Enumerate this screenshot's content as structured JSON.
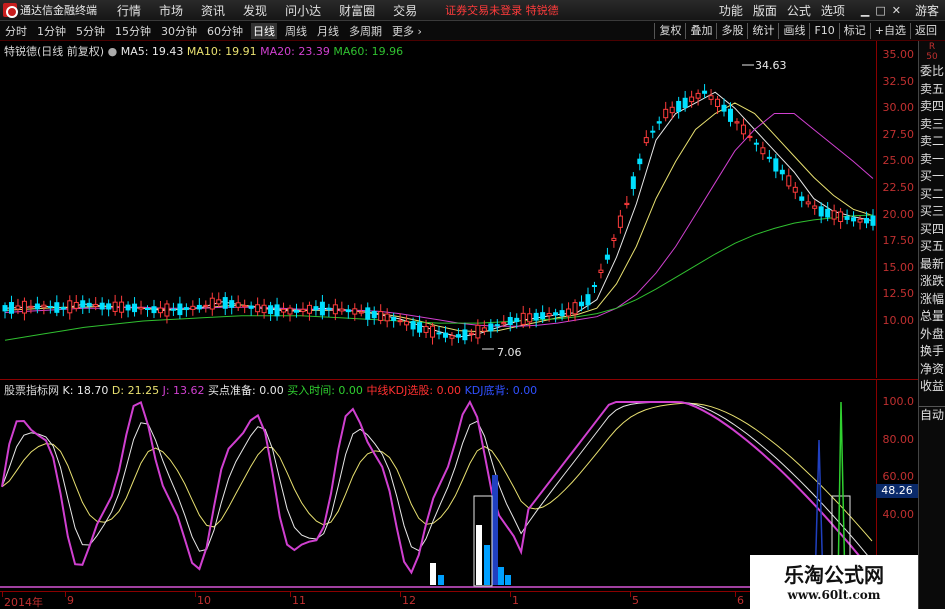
{
  "app": {
    "title": "通达信金融终端",
    "notice": "证券交易未登录",
    "notice2": "特锐德"
  },
  "menu": [
    "行情",
    "市场",
    "资讯",
    "发现",
    "问小达",
    "财富圈",
    "交易"
  ],
  "right_menu": [
    "功能",
    "版面",
    "公式",
    "选项",
    "游客"
  ],
  "periods": [
    "分时",
    "1分钟",
    "5分钟",
    "15分钟",
    "30分钟",
    "60分钟",
    "日线",
    "周线",
    "月线",
    "多周期",
    "更多"
  ],
  "active_period": "日线",
  "toolbar_right": [
    "复权",
    "叠加",
    "多股",
    "统计",
    "画线",
    "F10",
    "标记",
    "+自选",
    "返回"
  ],
  "price_legend": {
    "name": "特锐德(日线 前复权)",
    "ma5": "MA5: 19.43",
    "ma10": "MA10: 19.91",
    "ma20": "MA20: 23.39",
    "ma60": "MA60: 19.96"
  },
  "colors": {
    "up": "#ff3c3c",
    "down": "#00e0ff",
    "ma5": "#e8e8e8",
    "ma10": "#e8e070",
    "ma20": "#d040d0",
    "ma60": "#30c030"
  },
  "price_axis": [
    "35.00",
    "32.50",
    "30.00",
    "27.50",
    "25.00",
    "22.50",
    "20.00",
    "17.50",
    "15.00",
    "12.50",
    "10.00"
  ],
  "price_annotations": {
    "high": "34.63",
    "low": "7.06"
  },
  "ind_legend": {
    "name": "股票指标网",
    "k": "K: 18.70",
    "d": "D: 21.25",
    "j": "J: 13.62",
    "buy_prep": "买点准备: 0.00",
    "buy_time": "买入时间: 0.00",
    "mid": "中线KDJ选股: 0.00",
    "kdj": "KDJ底背: 0.00"
  },
  "ind_axis": [
    "100.0",
    "80.00",
    "60.00",
    "40.00"
  ],
  "ind_current": "48.26",
  "time_axis": [
    "2014年",
    "9",
    "10",
    "11",
    "12",
    "1",
    "5",
    "6"
  ],
  "side_buttons": [
    "委比",
    "卖五",
    "卖四",
    "卖三",
    "卖二",
    "卖一",
    "买一",
    "买二",
    "买三",
    "买四",
    "买五",
    "最新",
    "涨跌",
    "涨幅",
    "总量",
    "外盘",
    "换手",
    "净资",
    "收益",
    "自动"
  ],
  "side_top_label": "R\n50",
  "watermark": {
    "title": "乐淘公式网",
    "url": "www.60lt.com"
  },
  "chart_data": {
    "type": "line",
    "title": "特锐德(日线 前复权)",
    "ylim": [
      5,
      36
    ],
    "series": [
      {
        "name": "MA5",
        "values": [
          11.2,
          11.3,
          11.4,
          11.2,
          11.6,
          11.4,
          11.3,
          11.2,
          11.0,
          11.1,
          11.3,
          11.8,
          11.5,
          11.2,
          11.0,
          10.9,
          11.2,
          11.1,
          10.9,
          10.6,
          10.2,
          9.6,
          9.0,
          8.5,
          8.8,
          9.4,
          10.0,
          10.3,
          10.6,
          10.8,
          12.0,
          16,
          21,
          27,
          29.5,
          30.5,
          31.5,
          30,
          28,
          26,
          24,
          21.5,
          20.3,
          19.8,
          19.43
        ]
      },
      {
        "name": "MA10",
        "values": [
          11.0,
          11.1,
          11.2,
          11.3,
          11.3,
          11.4,
          11.3,
          11.2,
          11.1,
          11.1,
          11.2,
          11.4,
          11.5,
          11.3,
          11.1,
          11.0,
          11.0,
          11.0,
          10.9,
          10.7,
          10.4,
          10.0,
          9.5,
          9.1,
          9.0,
          9.1,
          9.5,
          9.9,
          10.3,
          10.6,
          11.2,
          13.5,
          17,
          21.5,
          25,
          28,
          29.5,
          30.5,
          29.5,
          27.5,
          25.5,
          23.5,
          21.8,
          20.5,
          19.91
        ]
      },
      {
        "name": "MA20",
        "values": [
          10.8,
          10.9,
          11.0,
          11.1,
          11.2,
          11.2,
          11.3,
          11.3,
          11.2,
          11.2,
          11.2,
          11.3,
          11.3,
          11.3,
          11.2,
          11.1,
          11.1,
          11.0,
          11.0,
          10.9,
          10.7,
          10.4,
          10.1,
          9.8,
          9.6,
          9.5,
          9.5,
          9.6,
          9.8,
          10.1,
          10.4,
          11.2,
          12.5,
          14.5,
          17,
          20,
          23,
          26,
          28,
          29.5,
          29.5,
          28,
          26.5,
          25,
          23.39
        ]
      },
      {
        "name": "MA60",
        "values": [
          8.2,
          8.5,
          8.8,
          9.1,
          9.4,
          9.6,
          9.8,
          10.0,
          10.1,
          10.2,
          10.3,
          10.4,
          10.5,
          10.5,
          10.5,
          10.5,
          10.4,
          10.3,
          10.2,
          10.1,
          10.0,
          9.9,
          9.8,
          9.8,
          9.8,
          9.9,
          10.0,
          10.1,
          10.2,
          10.4,
          10.7,
          11.2,
          12.0,
          13.0,
          14.1,
          15.2,
          16.3,
          17.3,
          18.1,
          18.7,
          19.2,
          19.5,
          19.7,
          19.9,
          19.96
        ]
      }
    ]
  }
}
